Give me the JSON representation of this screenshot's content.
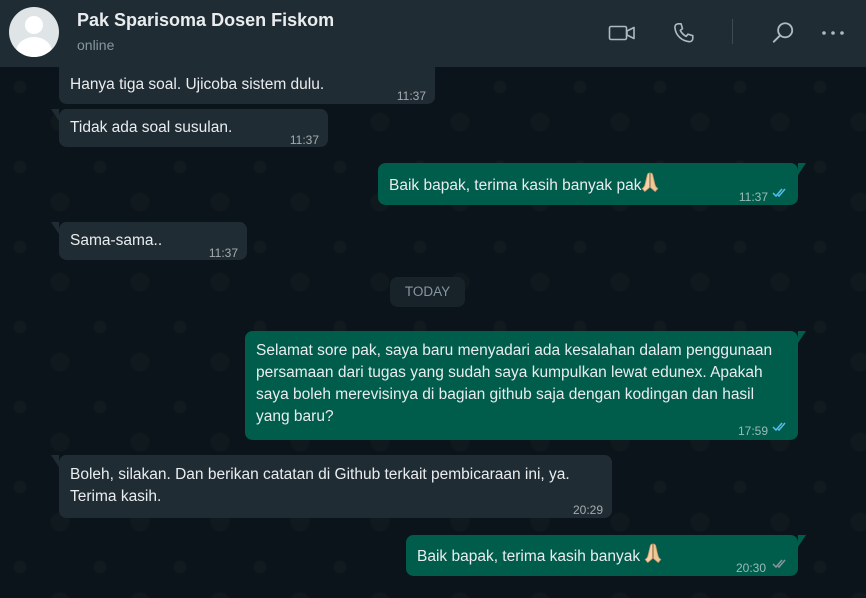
{
  "header": {
    "contact_name": "Pak Sparisoma Dosen Fiskom",
    "status": "online",
    "icons": [
      "video-call-icon",
      "voice-call-icon",
      "search-icon",
      "menu-icon"
    ]
  },
  "chat": {
    "date_divider": "TODAY",
    "messages": [
      {
        "dir": "in",
        "text": "Hanya tiga soal. Ujicoba sistem dulu.",
        "time": "11:37"
      },
      {
        "dir": "in",
        "text": "Tidak ada soal susulan.",
        "time": "11:37"
      },
      {
        "dir": "out",
        "text": "Baik bapak, terima kasih banyak pak",
        "emoji": "folded-hands",
        "time": "11:37",
        "status": "read"
      },
      {
        "dir": "in",
        "text": "Sama-sama..",
        "time": "11:37"
      },
      {
        "dir": "out",
        "text": "Selamat sore pak, saya baru menyadari ada kesalahan dalam penggunaan persamaan dari tugas yang sudah saya kumpulkan lewat edunex. Apakah saya boleh merevisinya di bagian github saja dengan kodingan dan hasil yang baru?",
        "time": "17:59",
        "status": "read"
      },
      {
        "dir": "in",
        "text": "Boleh, silakan. Dan berikan catatan di Github terkait pembicaraan ini, ya. Terima kasih.",
        "time": "20:29"
      },
      {
        "dir": "out",
        "text": "Baik bapak, terima kasih banyak ",
        "emoji": "folded-hands",
        "time": "20:30",
        "status": "delivered"
      }
    ]
  },
  "colors": {
    "header_bg": "#202c33",
    "chat_bg": "#0b141a",
    "incoming_bubble": "#202c33",
    "outgoing_bubble": "#005c4b",
    "read_tick": "#53bdeb",
    "delivered_tick": "#8696a0"
  }
}
